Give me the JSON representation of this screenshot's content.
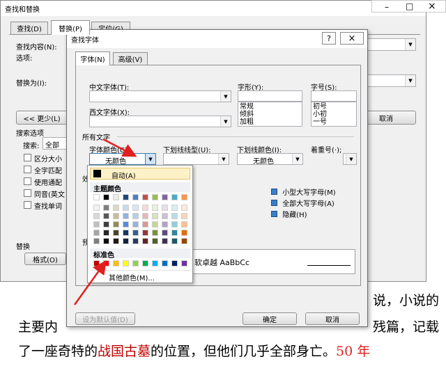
{
  "background_text": {
    "line1_left": "《",
    "line1_right": "说，小说的",
    "line2_left": "主要内",
    "line2_right": "残篇，记载",
    "line3_prefix": "了一座奇特的",
    "line3_highlight": "战国古墓",
    "line3_suffix": "的位置，但他们几乎全部身亡。",
    "line3_tail": "50 年"
  },
  "outer_dialog": {
    "title": "查找和替换",
    "tabs": [
      "查找(D)",
      "替换(P)",
      "定位(G)"
    ],
    "find_label": "查找内容(N):",
    "options_label": "选项:",
    "replace_label": "替换为(I):",
    "less_button": "<< 更少(L)",
    "cancel_button": "取消",
    "search_options_label": "搜索选项",
    "search_label": "搜索:",
    "search_value": "全部",
    "checkboxes": [
      "区分大小",
      "全字匹配",
      "使用通配",
      "同音(英文",
      "查找单词"
    ],
    "replace_section": "替换",
    "format_button": "格式(O)"
  },
  "font_dialog": {
    "title": "查找字体",
    "tabs": [
      "字体(N)",
      "高级(V)"
    ],
    "chinese_font_label": "中文字体(T):",
    "western_font_label": "西文字体(X):",
    "style_label": "字形(Y):",
    "style_options": [
      "常规",
      "倾斜",
      "加粗"
    ],
    "size_label": "字号(S):",
    "size_options": [
      "初号",
      "小初",
      "一号"
    ],
    "all_text_label": "所有文字",
    "font_color_label": "字体颜色(C):",
    "font_color_value": "无颜色",
    "underline_style_label": "下划线线型(U):",
    "underline_color_label": "下划线颜色(I):",
    "underline_color_value": "无颜色",
    "emphasis_label": "着重号(·);",
    "effects_label": "效",
    "effects": [
      "小型大写字母(M)",
      "全部大写字母(A)",
      "隐藏(H)"
    ],
    "preview_label": "预",
    "preview_text": "软卓越  AaBbCc",
    "default_button": "设为默认值(D)",
    "ok_button": "确定",
    "cancel_button": "取消",
    "help_icon": "?",
    "close_icon": "×"
  },
  "color_popup": {
    "auto_label": "自动(A)",
    "theme_label": "主题颜色",
    "standard_label": "标准色",
    "more_colors": "其他颜色(M)...",
    "theme_top": [
      "#ffffff",
      "#000000",
      "#eeece1",
      "#1f497d",
      "#4f81bd",
      "#c0504d",
      "#9bbb59",
      "#8064a2",
      "#4bacc6",
      "#f79646"
    ],
    "theme_shades": [
      [
        "#f2f2f2",
        "#7f7f7f",
        "#ddd9c3",
        "#c6d9f0",
        "#dbe5f1",
        "#f2dcdb",
        "#ebf1dd",
        "#e5e0ec",
        "#dbeef3",
        "#fdeada"
      ],
      [
        "#d8d8d8",
        "#595959",
        "#c4bd97",
        "#8db3e2",
        "#b8cce4",
        "#e5b9b7",
        "#d7e3bc",
        "#ccc1d9",
        "#b7dde8",
        "#fbd5b5"
      ],
      [
        "#bfbfbf",
        "#3f3f3f",
        "#938953",
        "#548dd4",
        "#95b3d7",
        "#d99694",
        "#c3d69b",
        "#b2a2c7",
        "#92cddc",
        "#fac08f"
      ],
      [
        "#a5a5a5",
        "#262626",
        "#494429",
        "#17365d",
        "#366092",
        "#953734",
        "#76923c",
        "#5f497a",
        "#31859b",
        "#e36c09"
      ],
      [
        "#7f7f7f",
        "#0c0c0c",
        "#1d1b10",
        "#0f243e",
        "#244061",
        "#632423",
        "#4f6128",
        "#3f3151",
        "#205867",
        "#974806"
      ]
    ],
    "standard": [
      "#c00000",
      "#ff0000",
      "#ffc000",
      "#ffff00",
      "#92d050",
      "#00b050",
      "#00b0f0",
      "#0070c0",
      "#002060",
      "#7030a0"
    ]
  }
}
